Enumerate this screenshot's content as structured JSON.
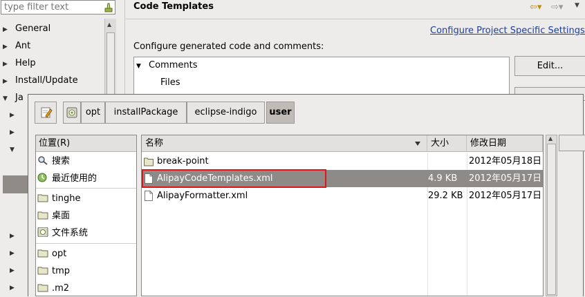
{
  "filter": {
    "placeholder": "type filter text"
  },
  "tree": [
    {
      "label": "General",
      "expanded": false
    },
    {
      "label": "Ant",
      "expanded": false
    },
    {
      "label": "Help",
      "expanded": false
    },
    {
      "label": "Install/Update",
      "expanded": false
    },
    {
      "label": "Ja",
      "expanded": true
    }
  ],
  "page": {
    "title": "Code Templates",
    "configure_link": "Configure Project Specific Settings...",
    "description": "Configure generated code and comments:",
    "templates": {
      "group": "Comments",
      "item": "Files"
    },
    "edit_button": "Edit..."
  },
  "file_chooser": {
    "path": [
      "opt",
      "installPackage",
      "eclipse-indigo",
      "user"
    ],
    "places_header": "位置(R)",
    "places": [
      {
        "label": "搜索",
        "icon": "search-icon"
      },
      {
        "label": "最近使用的",
        "icon": "recent-icon"
      },
      {
        "label": "tinghe",
        "icon": "folder-icon"
      },
      {
        "label": "桌面",
        "icon": "folder-icon"
      },
      {
        "label": "文件系统",
        "icon": "drive-icon"
      },
      {
        "label": "opt",
        "icon": "folder-icon"
      },
      {
        "label": "tmp",
        "icon": "folder-icon"
      },
      {
        "label": ".m2",
        "icon": "folder-icon"
      }
    ],
    "columns": {
      "name": "名称",
      "size": "大小",
      "modified": "修改日期"
    },
    "files": [
      {
        "name": "break-point",
        "size": "",
        "modified": "2012年05月18日",
        "type": "folder",
        "selected": false
      },
      {
        "name": "AlipayCodeTemplates.xml",
        "size": "4.9 KB",
        "modified": "2012年05月17日",
        "type": "file",
        "selected": true
      },
      {
        "name": "AlipayFormatter.xml",
        "size": "29.2 KB",
        "modified": "2012年05月17日",
        "type": "file",
        "selected": false
      }
    ],
    "selected_row_color": "#8d8a87",
    "annotation_color": "#e01414"
  }
}
